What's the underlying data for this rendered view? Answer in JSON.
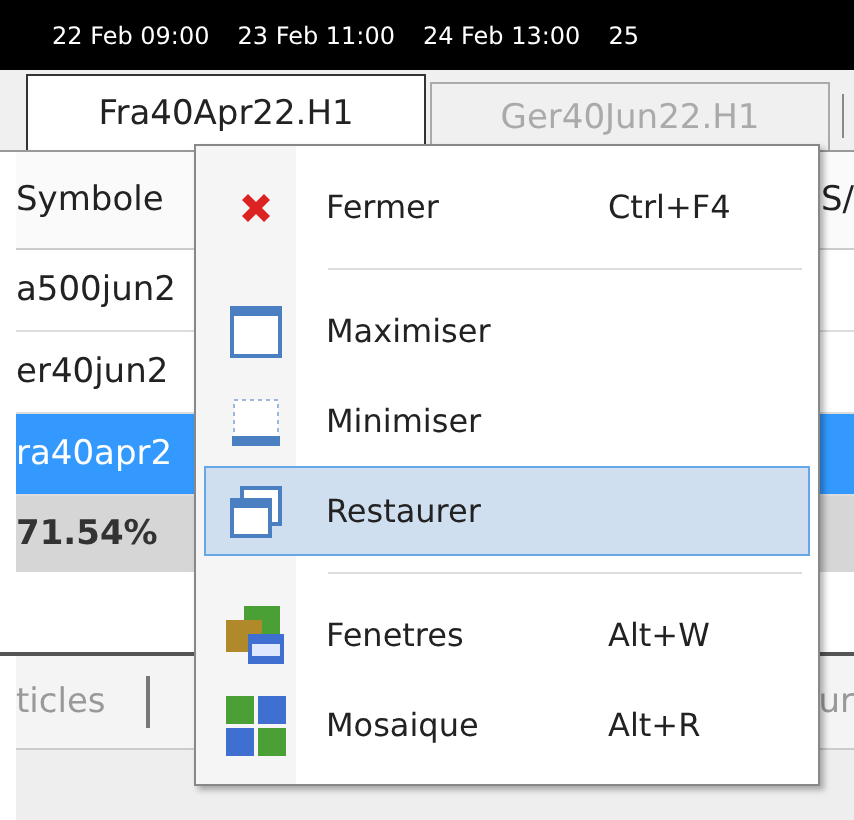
{
  "time_axis": [
    "22 Feb 09:00",
    "23 Feb 11:00",
    "24 Feb 13:00",
    "25"
  ],
  "chart_tabs": [
    {
      "label": "Fra40Apr22.H1",
      "selected": true
    },
    {
      "label": "Ger40Jun22.H1",
      "selected": false
    }
  ],
  "market_watch": {
    "column_1": "Symbole",
    "column_2": "S/",
    "rows": [
      {
        "symbol": "a500jun2",
        "selected": false
      },
      {
        "symbol": "er40jun2",
        "selected": false
      },
      {
        "symbol": "ra40apr2",
        "selected": true
      }
    ],
    "footer": "71.54%"
  },
  "bottom_tabs": [
    "ticles",
    "ur"
  ],
  "context_menu": [
    {
      "kind": "item",
      "label": "Fermer",
      "shortcut": "Ctrl+F4",
      "selected": false
    },
    {
      "kind": "separator"
    },
    {
      "kind": "item",
      "label": "Maximiser",
      "selected": false
    },
    {
      "kind": "item",
      "label": "Minimiser",
      "selected": false
    },
    {
      "kind": "item",
      "label": "Restaurer",
      "selected": true
    },
    {
      "kind": "separator"
    },
    {
      "kind": "item",
      "label": "Fenetres",
      "shortcut": "Alt+W",
      "selected": false
    },
    {
      "kind": "item",
      "label": "Mosaique",
      "shortcut": "Alt+R",
      "selected": false
    }
  ]
}
